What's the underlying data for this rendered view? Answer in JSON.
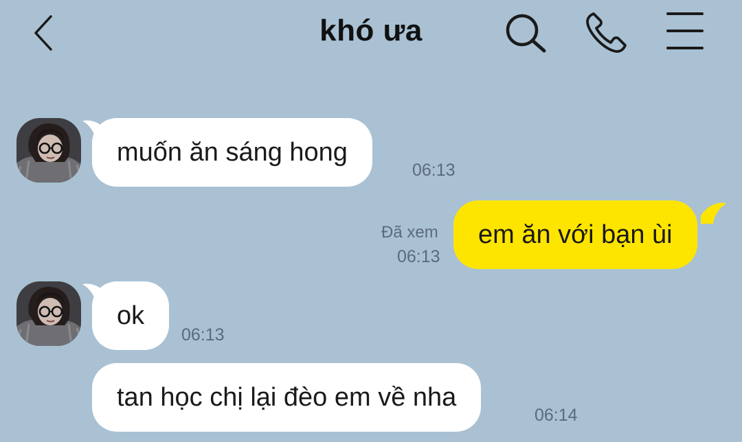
{
  "header": {
    "title": "khó ưa",
    "back_icon": "chevron-left-icon",
    "search_icon": "search-icon",
    "call_icon": "phone-icon",
    "menu_icon": "menu-icon"
  },
  "colors": {
    "background": "#a9c1d3",
    "incoming_bubble": "#ffffff",
    "outgoing_bubble": "#fee500",
    "meta_text": "#5b6b79"
  },
  "messages": [
    {
      "sender": "contact",
      "text": "muốn ăn sáng hong",
      "time": "06:13",
      "show_avatar": true
    },
    {
      "sender": "me",
      "text": "em ăn với bạn ùi",
      "time": "06:13",
      "status": "Đã xem"
    },
    {
      "sender": "contact",
      "text": "ok",
      "time": "06:13",
      "show_avatar": true
    },
    {
      "sender": "contact",
      "text": "tan học chị lại đèo em về nha",
      "time": "06:14",
      "show_avatar": false
    }
  ]
}
